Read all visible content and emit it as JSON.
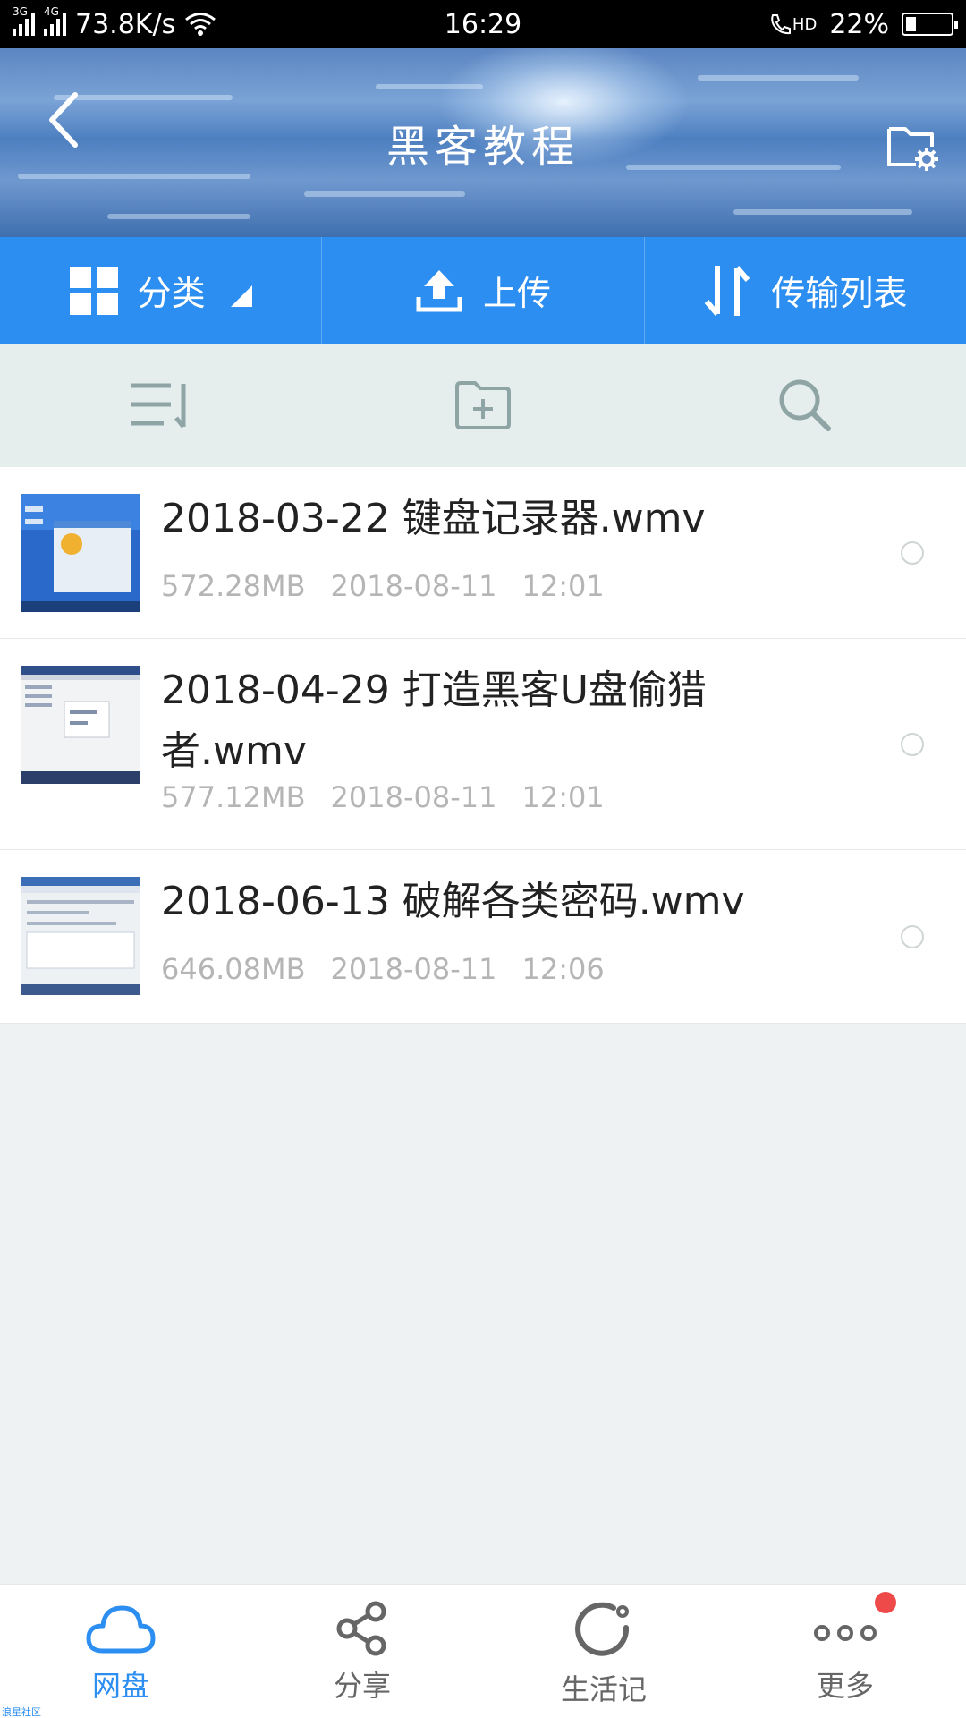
{
  "status_bar": {
    "net1": "3G",
    "net2": "4G",
    "speed": "73.8K/s",
    "time": "16:29",
    "hd": "HD",
    "battery": "22%",
    "battery_level": 0.22
  },
  "header": {
    "title": "黑客教程"
  },
  "actions": [
    {
      "label": "分类",
      "icon": "grid-icon"
    },
    {
      "label": "上传",
      "icon": "upload-icon"
    },
    {
      "label": "传输列表",
      "icon": "transfer-icon"
    }
  ],
  "toolbar": {
    "sort_icon": "sort-icon",
    "new_folder_icon": "folder-plus-icon",
    "search_icon": "search-icon"
  },
  "files": [
    {
      "name": "2018-03-22 键盘记录器.wmv",
      "size": "572.28MB",
      "date": "2018-08-11",
      "time": "12:01"
    },
    {
      "name": "2018-04-29 打造黑客U盘偷猎者.wmv",
      "size": "577.12MB",
      "date": "2018-08-11",
      "time": "12:01"
    },
    {
      "name": "2018-06-13 破解各类密码.wmv",
      "size": "646.08MB",
      "date": "2018-08-11",
      "time": "12:06"
    }
  ],
  "nav": [
    {
      "label": "网盘",
      "icon": "cloud-icon",
      "active": true
    },
    {
      "label": "分享",
      "icon": "share-icon",
      "active": false
    },
    {
      "label": "生活记",
      "icon": "life-icon",
      "active": false
    },
    {
      "label": "更多",
      "icon": "more-icon",
      "active": false
    }
  ],
  "colors": {
    "accent": "#2b8ef0",
    "badge": "#ef4a4a"
  },
  "watermark": "浪星社区"
}
